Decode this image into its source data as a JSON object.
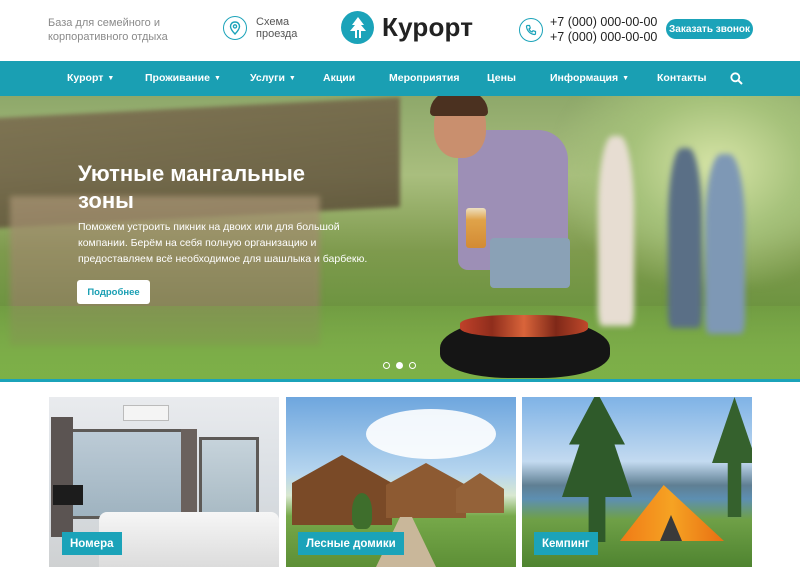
{
  "header": {
    "tagline": "База для семейного и корпоративного отдыха",
    "map_link": "Схема проезда",
    "logo_text": "Курорт",
    "phones": [
      "+7 (000) 000-00-00",
      "+7 (000) 000-00-00"
    ],
    "callback_label": "Заказать звонок"
  },
  "nav": {
    "items": [
      {
        "label": "Курорт",
        "dropdown": true
      },
      {
        "label": "Проживание",
        "dropdown": true
      },
      {
        "label": "Услуги",
        "dropdown": true
      },
      {
        "label": "Акции",
        "dropdown": false
      },
      {
        "label": "Мероприятия",
        "dropdown": false
      },
      {
        "label": "Цены",
        "dropdown": false
      },
      {
        "label": "Информация",
        "dropdown": true
      },
      {
        "label": "Контакты",
        "dropdown": false
      }
    ],
    "search_icon": "search-icon"
  },
  "hero": {
    "title": "Уютные мангальные зоны",
    "text": "Поможем устроить пикник на двоих или для большой компании. Берём на себя полную организацию и предоставляем всё необходимое для шашлыка и барбекю.",
    "button_label": "Подробнее",
    "slides_count": 3,
    "active_slide": 2
  },
  "cards": [
    {
      "label": "Номера"
    },
    {
      "label": "Лесные домики"
    },
    {
      "label": "Кемпинг"
    }
  ],
  "colors": {
    "accent": "#1ba3b9",
    "nav_bg": "#1a9fb3"
  }
}
